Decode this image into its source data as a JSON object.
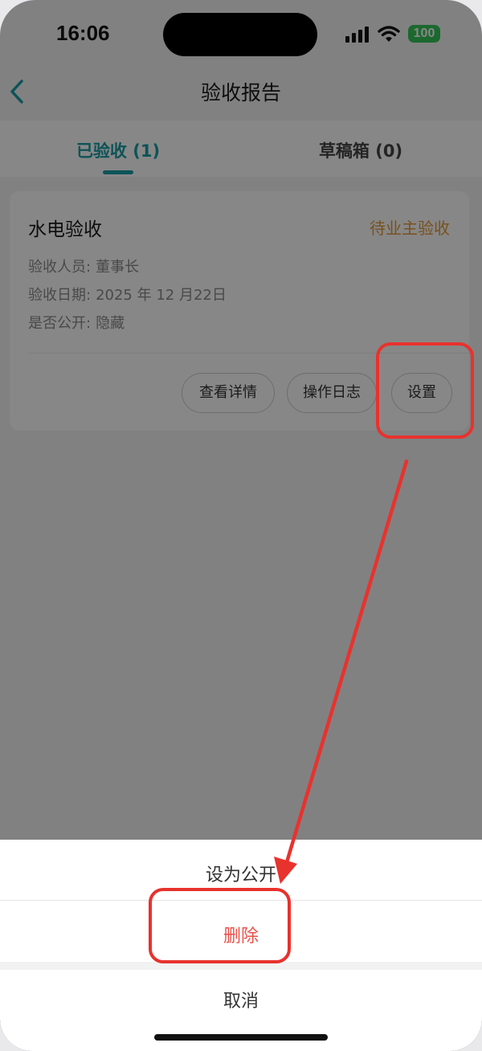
{
  "status_bar": {
    "time": "16:06",
    "battery": "100"
  },
  "nav": {
    "title": "验收报告"
  },
  "tabs": [
    {
      "label": "已验收 (1)"
    },
    {
      "label": "草稿箱 (0)"
    }
  ],
  "card": {
    "title": "水电验收",
    "status": "待业主验收",
    "inspector_label": "验收人员:",
    "inspector": "董事长",
    "date_label": "验收日期:",
    "date": "2025 年 12 月22日",
    "public_label": "是否公开:",
    "public": "隐藏",
    "buttons": {
      "view": "查看详情",
      "log": "操作日志",
      "settings": "设置"
    }
  },
  "sheet": {
    "set_public": "设为公开",
    "delete": "删除",
    "cancel": "取消"
  },
  "colors": {
    "accent": "#1a9ea6",
    "status": "#e39a3b",
    "danger": "#e8322d"
  }
}
